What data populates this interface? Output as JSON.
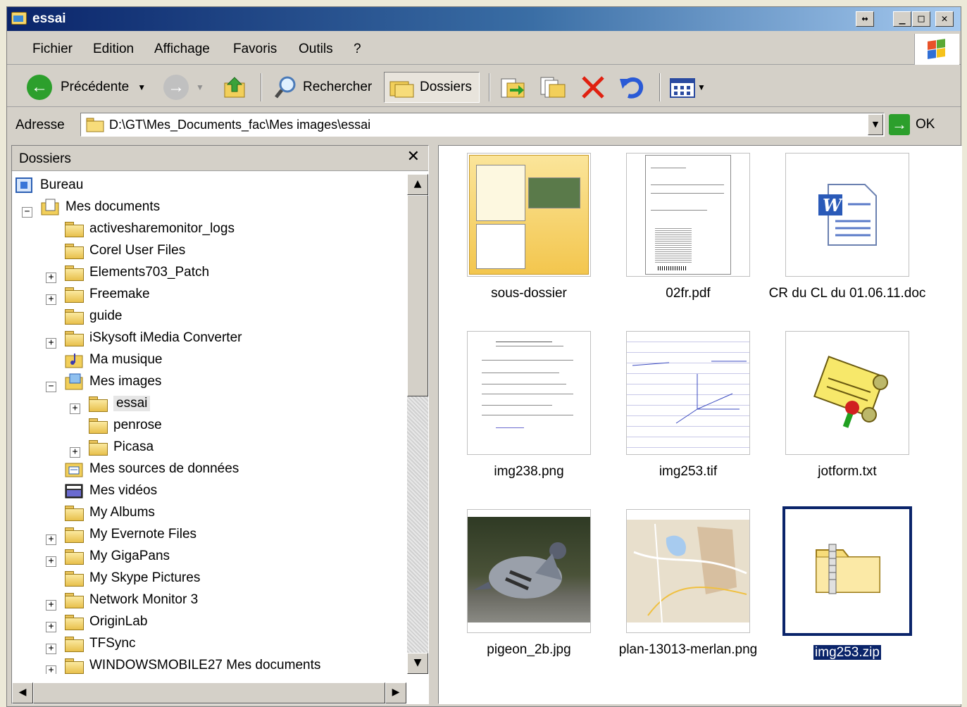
{
  "window": {
    "title": "essai",
    "buttons": {
      "resize": "↔",
      "minimize": "_",
      "maximize": "□",
      "close": "✕"
    }
  },
  "menu": {
    "items": [
      "Fichier",
      "Edition",
      "Affichage",
      "Favoris",
      "Outils",
      "?"
    ]
  },
  "toolbar": {
    "back_label": "Précédente",
    "search_label": "Rechercher",
    "folders_label": "Dossiers"
  },
  "address": {
    "label": "Adresse",
    "path": "D:\\GT\\Mes_Documents_fac\\Mes images\\essai",
    "go_label": "OK"
  },
  "folders_pane": {
    "title": "Dossiers",
    "close": "✕",
    "tree": [
      {
        "label": "Bureau"
      },
      {
        "label": "Mes documents"
      },
      {
        "label": "activesharemonitor_logs"
      },
      {
        "label": "Corel User Files"
      },
      {
        "label": "Elements703_Patch"
      },
      {
        "label": "Freemake"
      },
      {
        "label": "guide"
      },
      {
        "label": "iSkysoft iMedia Converter"
      },
      {
        "label": "Ma musique"
      },
      {
        "label": "Mes images"
      },
      {
        "label": "essai"
      },
      {
        "label": "penrose"
      },
      {
        "label": "Picasa"
      },
      {
        "label": "Mes sources de données"
      },
      {
        "label": "Mes vidéos"
      },
      {
        "label": "My Albums"
      },
      {
        "label": "My Evernote Files"
      },
      {
        "label": "My GigaPans"
      },
      {
        "label": "My Skype Pictures"
      },
      {
        "label": "Network Monitor 3"
      },
      {
        "label": "OriginLab"
      },
      {
        "label": "TFSync"
      },
      {
        "label": "WINDOWSMOBILE27 Mes documents"
      }
    ]
  },
  "files": [
    {
      "name": "sous-dossier"
    },
    {
      "name": "02fr.pdf"
    },
    {
      "name": "CR du CL du 01.06.11.doc"
    },
    {
      "name": "img238.png"
    },
    {
      "name": "img253.tif"
    },
    {
      "name": "jotform.txt"
    },
    {
      "name": "pigeon_2b.jpg"
    },
    {
      "name": "plan-13013-merlan.png"
    },
    {
      "name": "img253.zip"
    }
  ],
  "colors": {
    "title_gradient_start": "#0a246a",
    "title_gradient_end": "#a6caf0",
    "selection": "#0a246a",
    "face": "#d4d0c8"
  }
}
